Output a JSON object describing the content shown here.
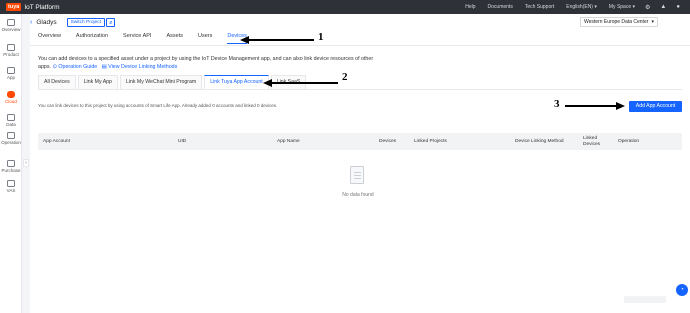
{
  "topbar": {
    "logo": "tuya",
    "title": "IoT Platform",
    "nav": [
      "Help",
      "Documents",
      "Tech Support",
      "English(EN)",
      "My Space"
    ],
    "icons": [
      "gear-icon",
      "bell-icon",
      "user-icon"
    ]
  },
  "sidebar": {
    "items": [
      {
        "label": "Overview",
        "icon": "home-icon"
      },
      {
        "label": "Product",
        "icon": "product-icon"
      },
      {
        "label": "App",
        "icon": "phone-icon"
      },
      {
        "label": "Cloud",
        "icon": "cloud-icon",
        "active": true
      },
      {
        "label": "Data",
        "icon": "chart-icon"
      },
      {
        "label": "Operation",
        "icon": "operation-icon"
      },
      {
        "label": "Purchase",
        "icon": "cart-icon"
      },
      {
        "label": "VAS",
        "icon": "vas-icon"
      }
    ]
  },
  "header": {
    "project": "Gladys",
    "switch_label": "Switch Project",
    "data_center": "Western Europe Data Center"
  },
  "tabs": [
    "Overview",
    "Authorization",
    "Service API",
    "Assets",
    "Users",
    "Devices"
  ],
  "description": {
    "text": "You can add devices to a specified asset under a project by using the IoT Device Management app, and can also link device resources of other apps.",
    "link1": "Operation Guide",
    "link2": "View Device Linking Methods"
  },
  "subtabs": [
    "All Devices",
    "Link My App",
    "Link My WeChat Mini Program",
    "Link Tuya App Account",
    "Link SaaS"
  ],
  "info_text": "You can link devices to this project by using accounts of Smart Life App. Already added 0 accounts and linked 0 devices.",
  "add_button": "Add App Account",
  "table": {
    "columns": [
      "App Account",
      "UID",
      "App Name",
      "Devices",
      "Linked Projects",
      "Device Linking Method",
      "Linked Devices",
      "Operation"
    ]
  },
  "empty_text": "No data found",
  "annotations": [
    "1",
    "2",
    "3"
  ],
  "colors": {
    "accent": "#1664ff",
    "brand": "#ff4800",
    "topbar": "#2e3138"
  }
}
